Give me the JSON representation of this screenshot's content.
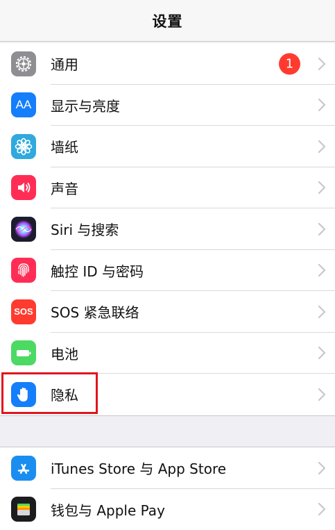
{
  "nav": {
    "title": "设置"
  },
  "items": [
    {
      "label": "通用",
      "icon": "gear-icon",
      "color": "#8e8e93",
      "badge": "1"
    },
    {
      "label": "显示与亮度",
      "icon": "text-size-icon",
      "color": "#157efb",
      "icon_text": "AA"
    },
    {
      "label": "墙纸",
      "icon": "flower-icon",
      "color": "#30a9de"
    },
    {
      "label": "声音",
      "icon": "speaker-icon",
      "color": "#ff2d55"
    },
    {
      "label": "Siri 与搜索",
      "icon": "siri-icon",
      "color": "#1c1c2e"
    },
    {
      "label": "触控 ID 与密码",
      "icon": "fingerprint-icon",
      "color": "#ff2d55"
    },
    {
      "label": "SOS 紧急联络",
      "icon": "sos-icon",
      "color": "#ff3b30",
      "icon_text": "SOS"
    },
    {
      "label": "电池",
      "icon": "battery-icon",
      "color": "#4cd964"
    },
    {
      "label": "隐私",
      "icon": "hand-icon",
      "color": "#157efb"
    }
  ],
  "items2": [
    {
      "label": "iTunes Store 与 App Store",
      "icon": "app-store-icon",
      "color": "#1a8df0",
      "icon_text": "A"
    },
    {
      "label": "钱包与 Apple Pay",
      "icon": "wallet-icon",
      "color": "#1c1c1e"
    }
  ],
  "highlight_color": "#e0141e"
}
